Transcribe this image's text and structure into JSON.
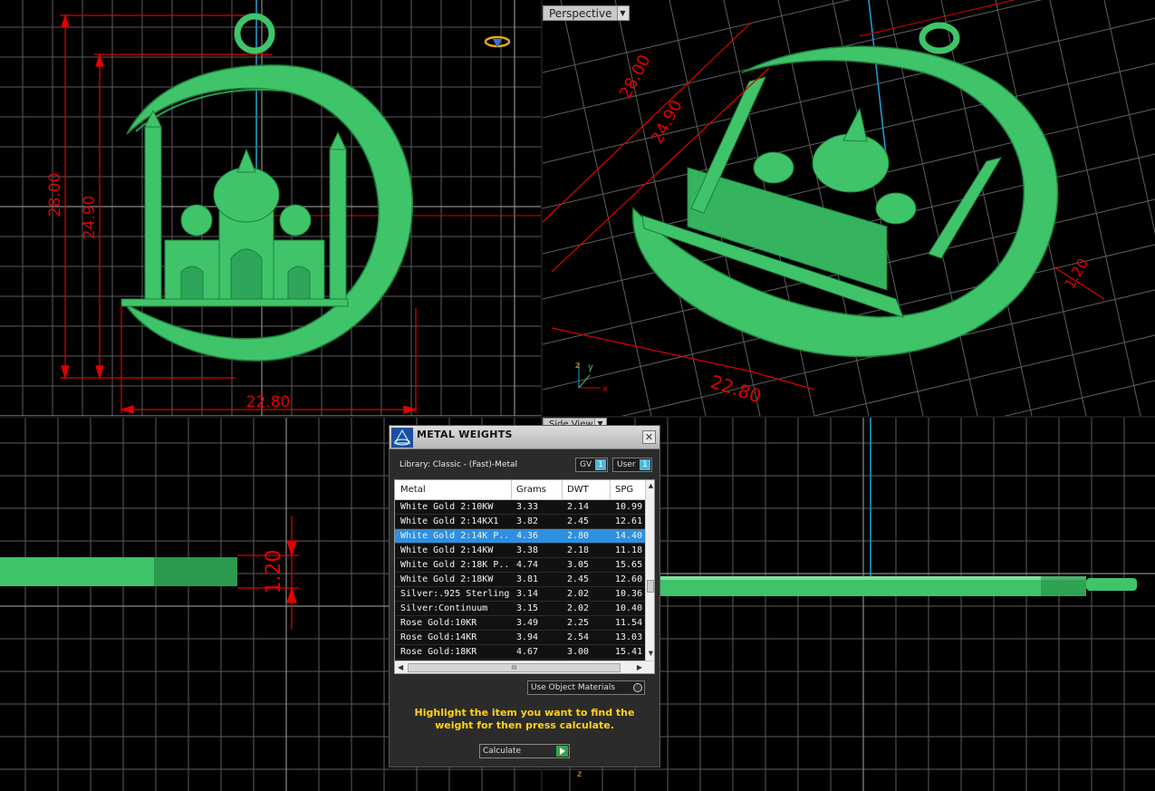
{
  "colors": {
    "model": "#3fc46a",
    "model_dark": "#1f7f3c",
    "dimension": "#e00000",
    "grid": "#6a6a6a",
    "axis_blue": "#1ea4d6",
    "selection": "#2f8fe0",
    "hint": "#ffd21a"
  },
  "viewports": {
    "top_left": {
      "dim_height_outer": "28.00",
      "dim_height_inner": "24.90",
      "dim_width": "22.80"
    },
    "top_right": {
      "label": "Perspective",
      "dim_height_outer": "28.00",
      "dim_height_inner": "24.90",
      "dim_width": "22.80",
      "dim_thickness": "1.20",
      "axis_y": "y",
      "axis_z": "z",
      "axis_x": "x"
    },
    "bottom_left": {
      "dim_thickness": "1.20"
    },
    "bottom_right": {
      "label": "Side View",
      "axis_z": "z"
    }
  },
  "dialog": {
    "title": "METAL WEIGHTS",
    "close_glyph": "✕",
    "library": "Library: Classic - (Fast)-Metal",
    "toggle_gv": "GV",
    "toggle_user": "User",
    "toggle_value": "1",
    "columns": [
      "Metal",
      "Grams",
      "DWT",
      "SPG"
    ],
    "rows": [
      {
        "metal": "White Gold 2:10KW",
        "grams": "3.33",
        "dwt": "2.14",
        "spg": "10.99"
      },
      {
        "metal": "White Gold 2:14KX1",
        "grams": "3.82",
        "dwt": "2.45",
        "spg": "12.61"
      },
      {
        "metal": "White Gold 2:14K P...",
        "grams": "4.36",
        "dwt": "2.80",
        "spg": "14.40"
      },
      {
        "metal": "White Gold 2:14KW",
        "grams": "3.38",
        "dwt": "2.18",
        "spg": "11.18"
      },
      {
        "metal": "White Gold 2:18K P...",
        "grams": "4.74",
        "dwt": "3.05",
        "spg": "15.65"
      },
      {
        "metal": "White Gold 2:18KW",
        "grams": "3.81",
        "dwt": "2.45",
        "spg": "12.60"
      },
      {
        "metal": "Silver:.925 Sterling",
        "grams": "3.14",
        "dwt": "2.02",
        "spg": "10.36"
      },
      {
        "metal": "Silver:Continuum",
        "grams": "3.15",
        "dwt": "2.02",
        "spg": "10.40"
      },
      {
        "metal": "Rose Gold:10KR",
        "grams": "3.49",
        "dwt": "2.25",
        "spg": "11.54"
      },
      {
        "metal": "Rose Gold:14KR",
        "grams": "3.94",
        "dwt": "2.54",
        "spg": "13.03"
      },
      {
        "metal": "Rose Gold:18KR",
        "grams": "4.67",
        "dwt": "3.00",
        "spg": "15.41"
      }
    ],
    "selected_row": 2,
    "use_object_materials": "Use Object Materials",
    "hint": "Highlight the item you want to find the weight for then press calculate.",
    "calculate": "Calculate",
    "scroll_thumb": "III"
  }
}
